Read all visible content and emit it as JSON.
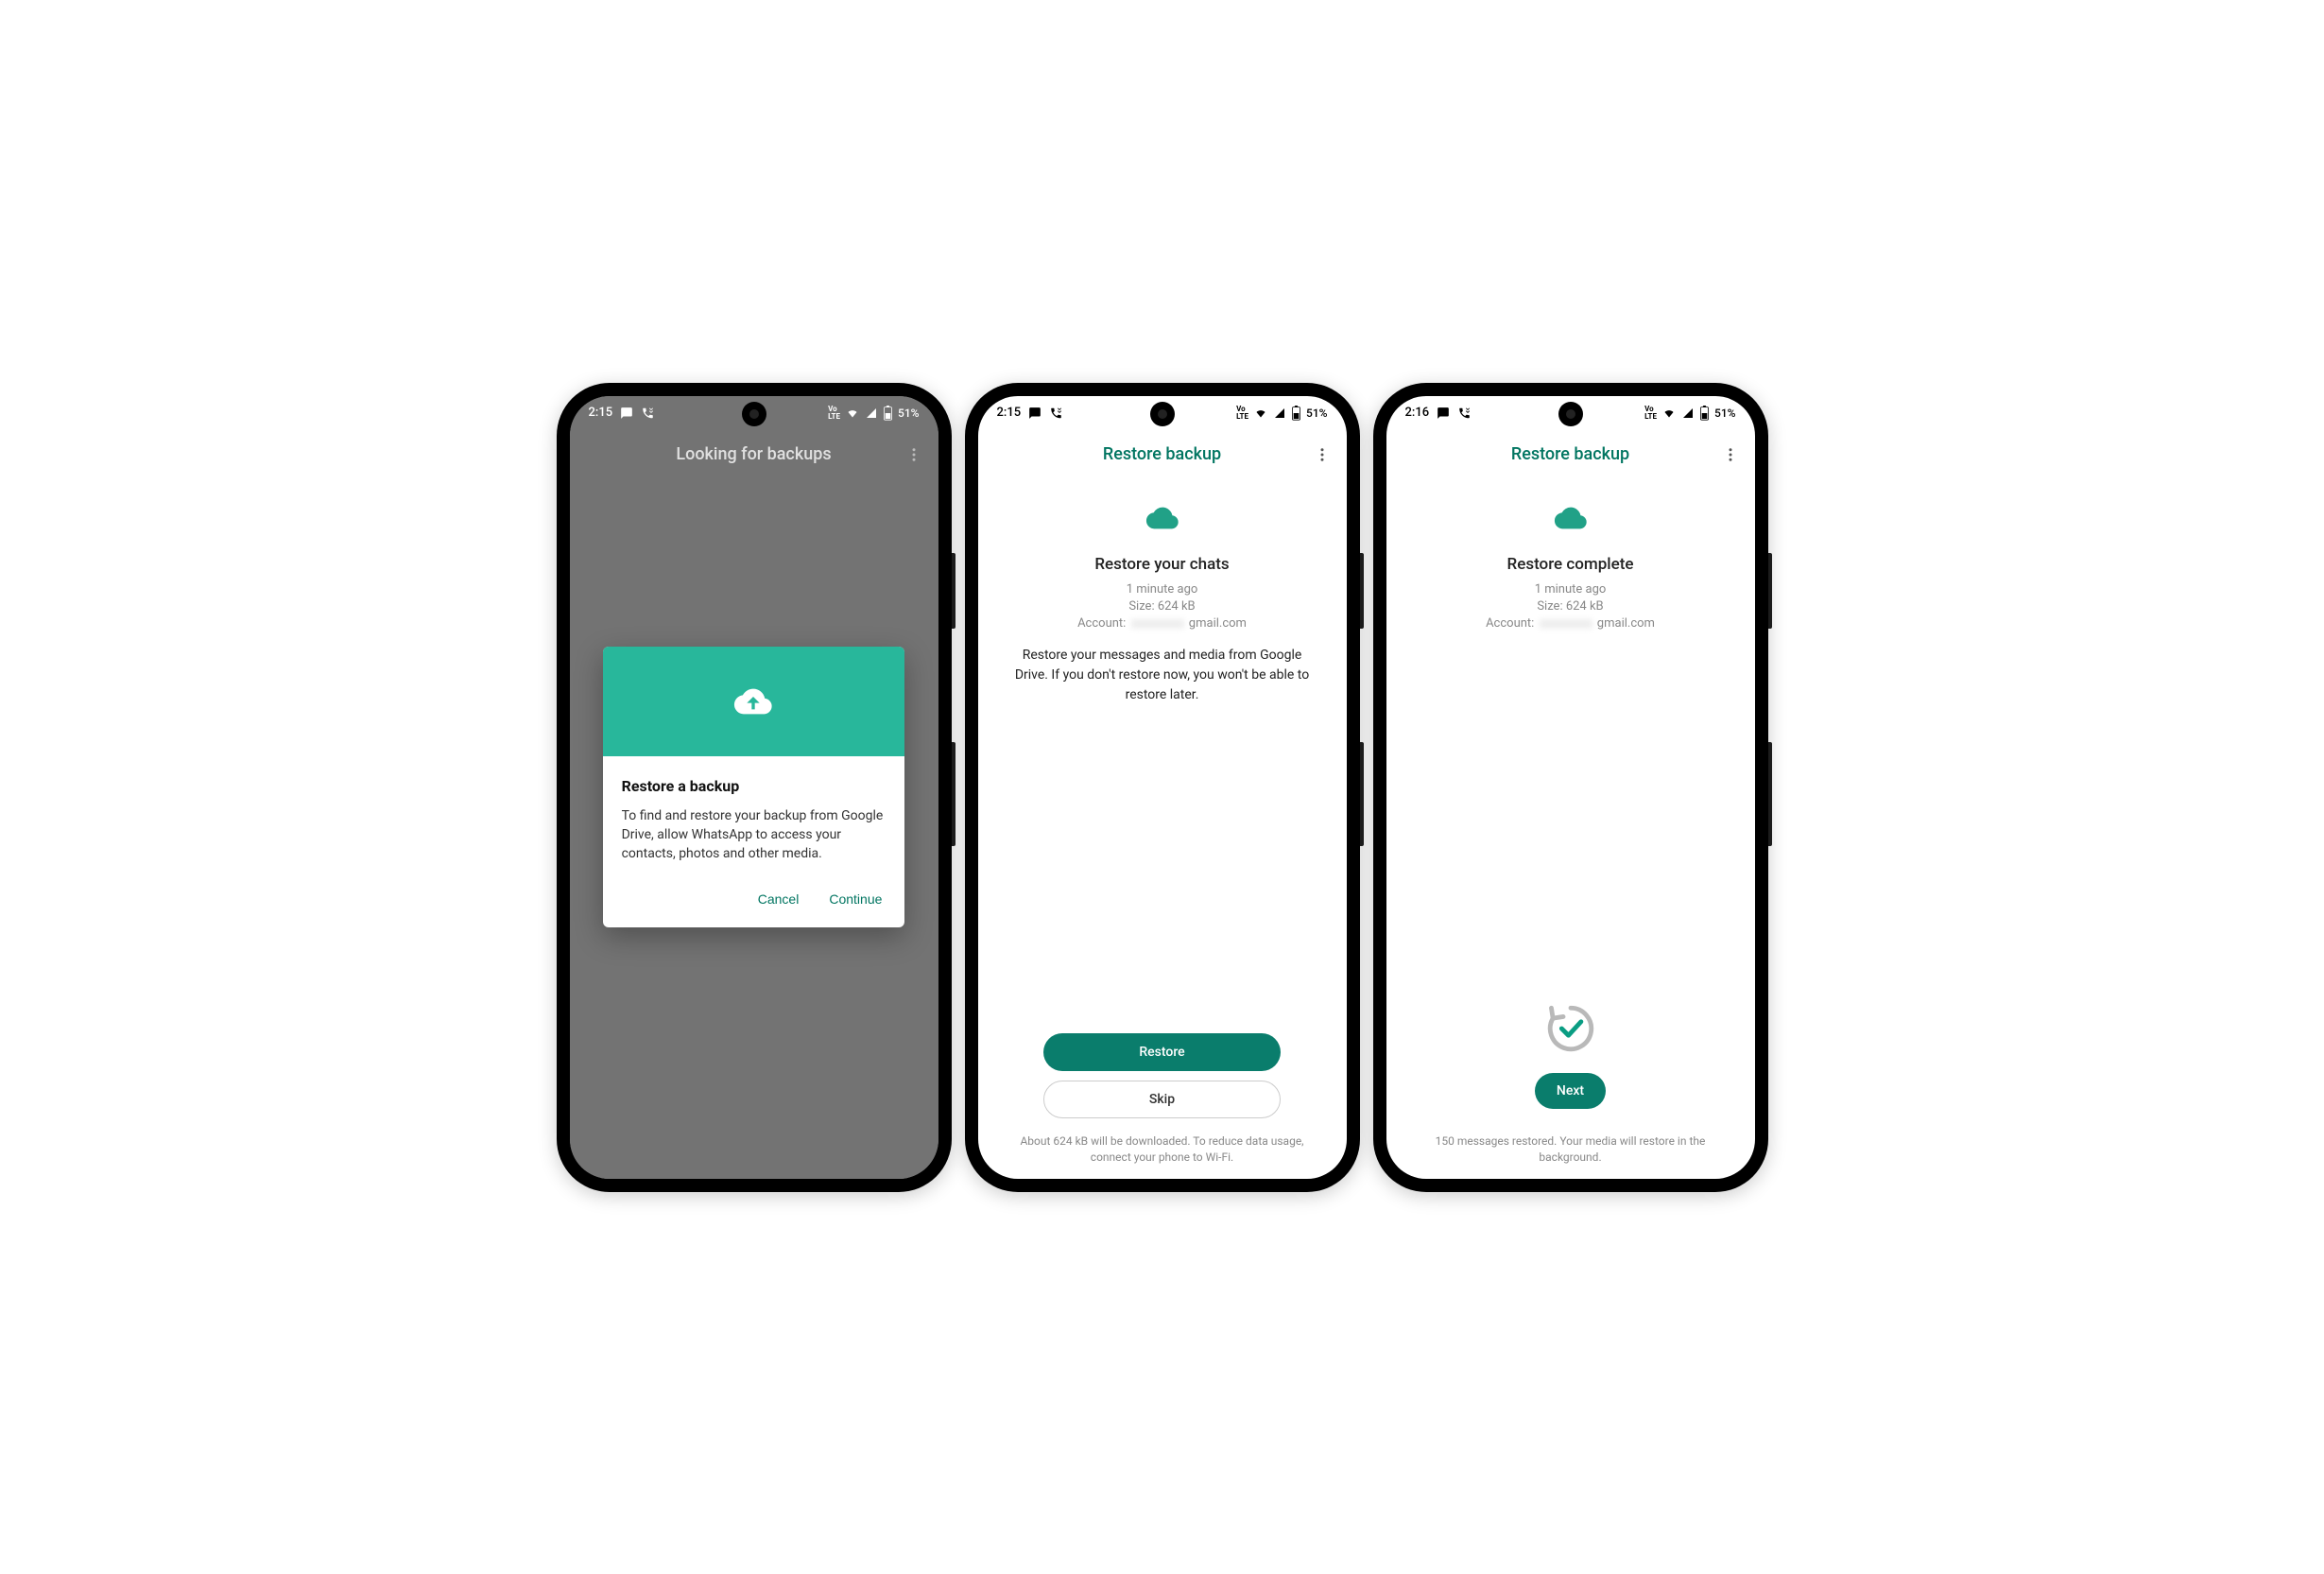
{
  "statusbar": {
    "time1": "2:15",
    "time2": "2:15",
    "time3": "2:16",
    "battery": "51%"
  },
  "screen1": {
    "appbar_title": "Looking for backups",
    "dialog_title": "Restore a backup",
    "dialog_body": "To find and restore your backup from Google Drive, allow WhatsApp to access your contacts, photos and other media.",
    "cancel": "Cancel",
    "continue": "Continue"
  },
  "screen2": {
    "appbar_title": "Restore backup",
    "heading": "Restore your chats",
    "meta_time": "1 minute ago",
    "meta_size": "Size: 624 kB",
    "account_label": "Account:",
    "account_domain": "gmail.com",
    "desc": "Restore your messages and media from Google Drive. If you don't restore now, you won't be able to restore later.",
    "restore": "Restore",
    "skip": "Skip",
    "footnote": "About 624 kB will be downloaded. To reduce data usage, connect your phone to Wi-Fi."
  },
  "screen3": {
    "appbar_title": "Restore backup",
    "heading": "Restore complete",
    "meta_time": "1 minute ago",
    "meta_size": "Size: 624 kB",
    "account_label": "Account:",
    "account_domain": "gmail.com",
    "next": "Next",
    "footnote": "150 messages restored. Your media will restore in the background."
  }
}
